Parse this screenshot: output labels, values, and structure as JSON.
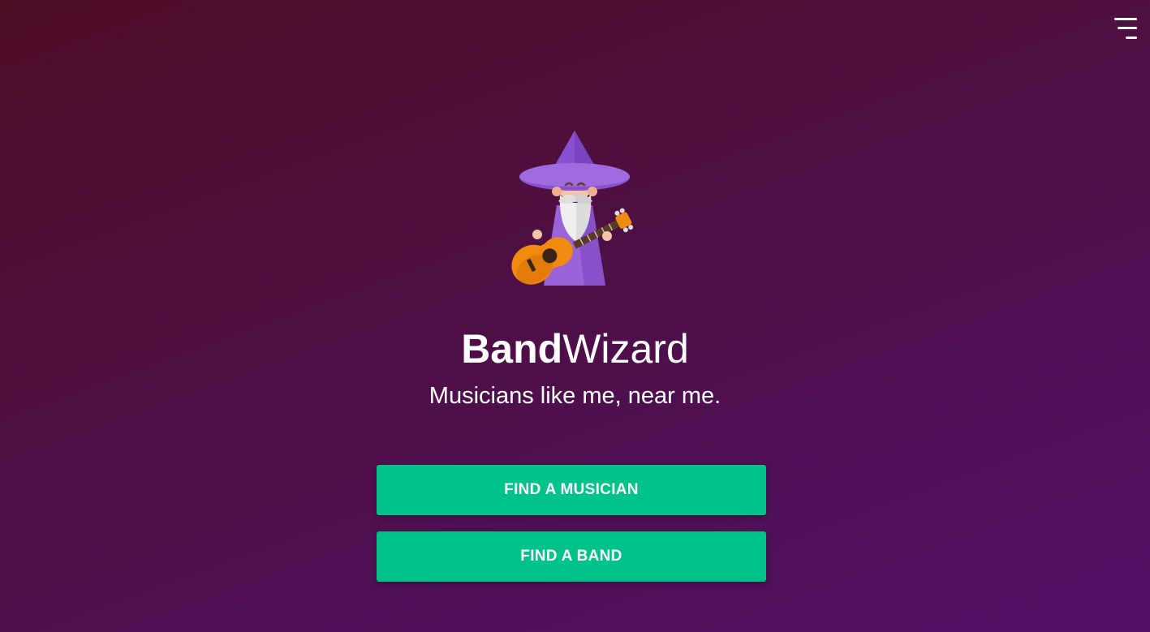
{
  "header": {
    "menu_icon": "hamburger-menu-icon"
  },
  "hero": {
    "logo_icon": "wizard-with-guitar-icon",
    "title_bold": "Band",
    "title_regular": "Wizard",
    "tagline": "Musicians like me, near me."
  },
  "actions": {
    "find_musician_label": "FIND A MUSICIAN",
    "find_band_label": "FIND A BAND"
  },
  "colors": {
    "background_start": "#4b0c24",
    "background_end": "#521165",
    "button": "#00c389",
    "text": "#ffffff"
  }
}
